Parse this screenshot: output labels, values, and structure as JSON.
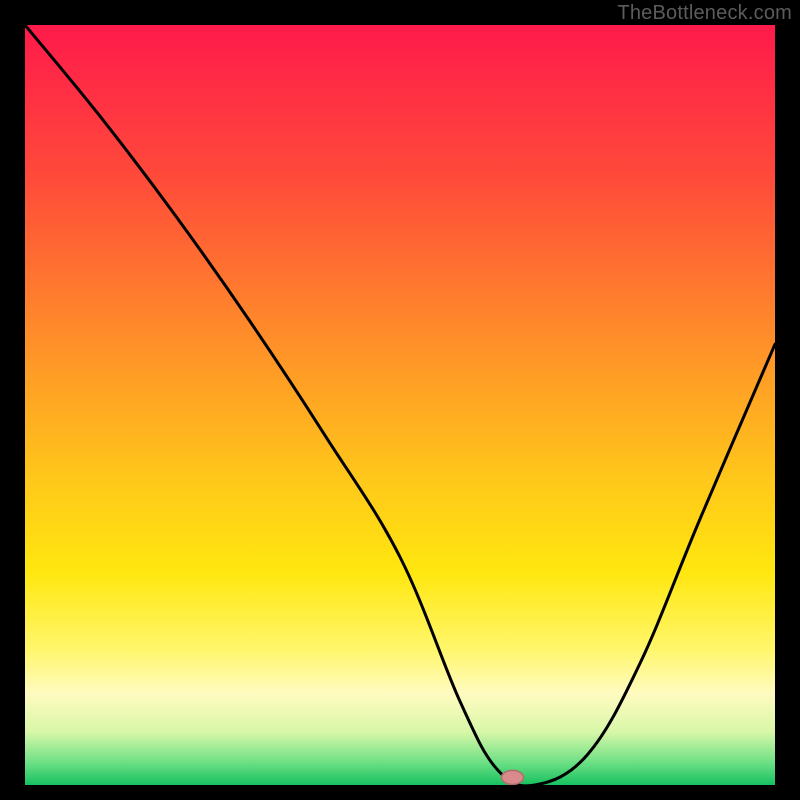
{
  "watermark": "TheBottleneck.com",
  "chart_data": {
    "type": "line",
    "title": "",
    "xlabel": "",
    "ylabel": "",
    "xlim": [
      0,
      100
    ],
    "ylim": [
      0,
      100
    ],
    "series": [
      {
        "name": "bottleneck-curve",
        "x": [
          0,
          10,
          20,
          30,
          40,
          50,
          58,
          63,
          68,
          75,
          82,
          90,
          100
        ],
        "y": [
          100,
          88,
          75,
          61,
          46,
          30,
          11,
          2,
          0,
          4,
          16,
          35,
          58
        ]
      }
    ],
    "marker": {
      "x": 65,
      "y": 1
    },
    "gradient_stops": [
      {
        "offset": 0.0,
        "color": "#ff1a4b"
      },
      {
        "offset": 0.2,
        "color": "#ff4a3a"
      },
      {
        "offset": 0.4,
        "color": "#ff8a2a"
      },
      {
        "offset": 0.6,
        "color": "#ffc81a"
      },
      {
        "offset": 0.72,
        "color": "#ffe70f"
      },
      {
        "offset": 0.82,
        "color": "#fff66a"
      },
      {
        "offset": 0.88,
        "color": "#fffbc0"
      },
      {
        "offset": 0.93,
        "color": "#d8f7a8"
      },
      {
        "offset": 0.97,
        "color": "#6ee085"
      },
      {
        "offset": 1.0,
        "color": "#16c160"
      }
    ]
  }
}
